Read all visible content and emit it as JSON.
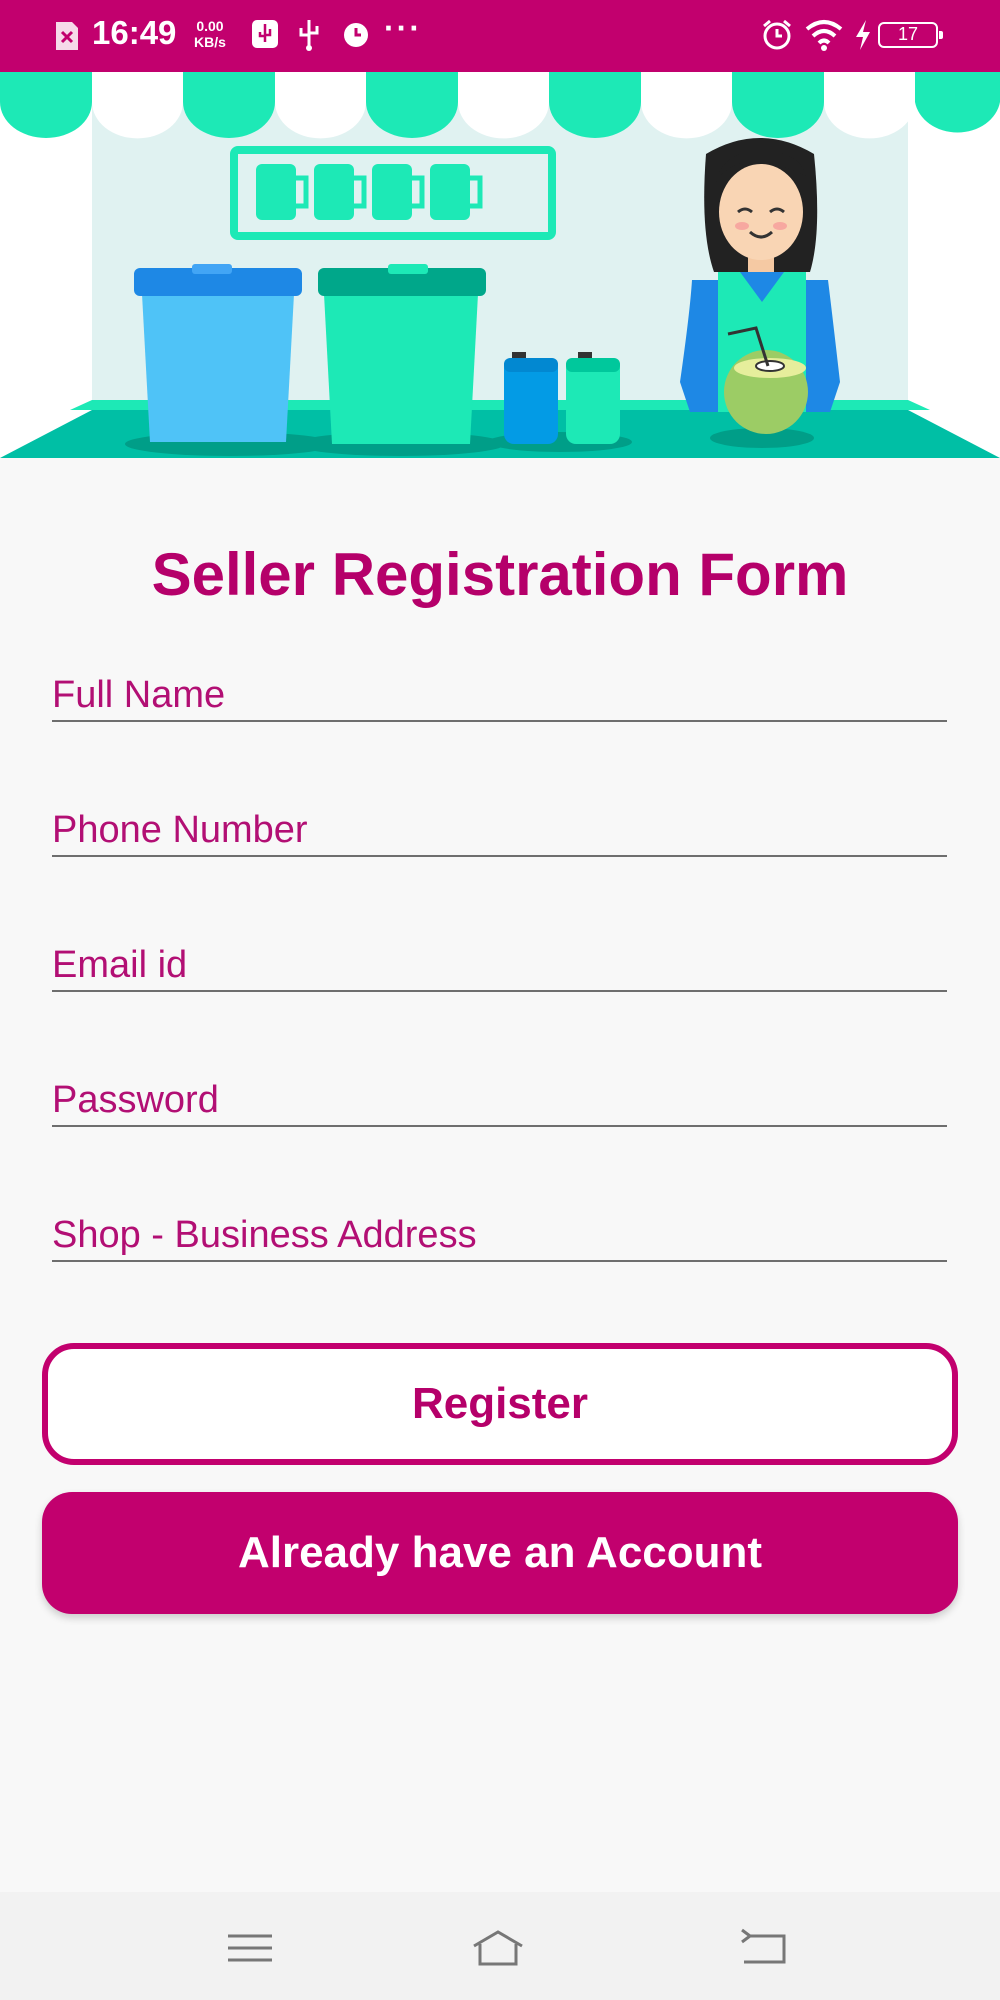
{
  "status_bar": {
    "time": "16:49",
    "net_speed_value": "0.00",
    "net_speed_unit": "KB/s",
    "battery": "17",
    "icons": [
      "sim-error-icon",
      "usb-debug-icon",
      "usb-icon",
      "alarm-icon",
      "more-icon",
      "alarm-icon",
      "wifi-icon",
      "charging-icon",
      "battery-icon"
    ]
  },
  "form": {
    "title": "Seller Registration Form",
    "fields": {
      "full_name": {
        "placeholder": "Full Name",
        "value": ""
      },
      "phone": {
        "placeholder": "Phone Number",
        "value": ""
      },
      "email": {
        "placeholder": "Email id",
        "value": ""
      },
      "password": {
        "placeholder": "Password",
        "value": ""
      },
      "address": {
        "placeholder": "Shop - Business Address",
        "value": ""
      }
    },
    "register_label": "Register",
    "login_label": "Already have an Account"
  },
  "nav_bar": {
    "icons": [
      "menu-icon",
      "home-icon",
      "back-icon"
    ]
  },
  "colors": {
    "primary": "#c2006e",
    "accent_green": "#1de9b6",
    "background": "#f8f8f8"
  }
}
